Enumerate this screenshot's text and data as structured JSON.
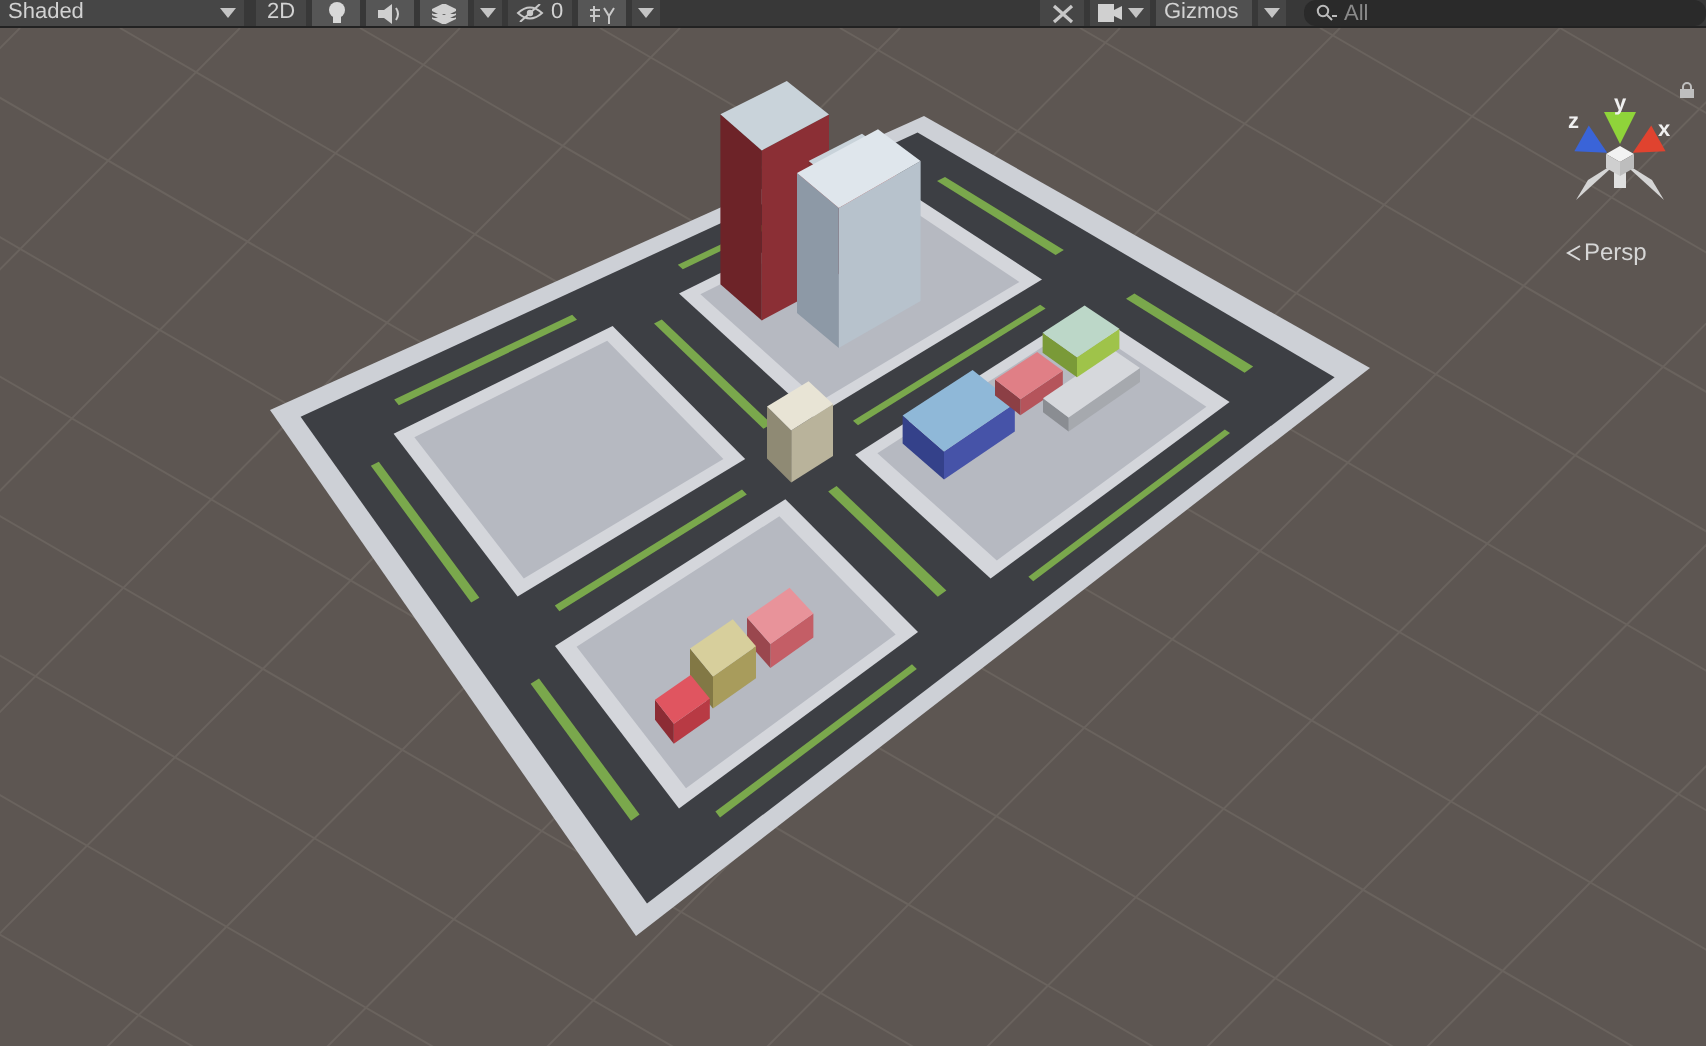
{
  "toolbar": {
    "shading_mode": "Shaded",
    "mode_2d": {
      "label": "2D",
      "selected": false
    },
    "lighting": {
      "on": true
    },
    "audio": {
      "on": true
    },
    "effects": {
      "on": true
    },
    "hidden_count": "0",
    "grid": {
      "on": true
    },
    "gizmos": "Gizmos",
    "search": {
      "placeholder": "All"
    }
  },
  "orientation_gizmo": {
    "axes": [
      {
        "label": "y",
        "color": "#8fd43a"
      },
      {
        "label": "z",
        "color": "#3a64d8"
      },
      {
        "label": "x",
        "color": "#e0432f"
      }
    ],
    "projection": "Persp"
  }
}
